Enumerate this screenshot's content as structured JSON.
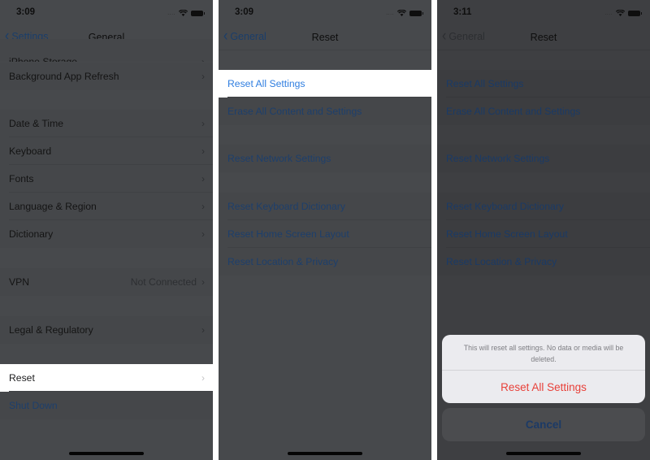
{
  "colors": {
    "ios_blue": "#2f7ee0",
    "destructive_red": "#e8413a",
    "dim_overlay_bg": "#47494c",
    "highlight_bg": "#ffffff"
  },
  "screens": [
    {
      "status": {
        "time": "3:09",
        "signal_icon": "signal-dots-icon",
        "wifi_icon": "wifi-icon",
        "battery_icon": "battery-icon"
      },
      "nav": {
        "back_label": "Settings",
        "title": "General"
      },
      "rows": [
        {
          "label": "iPhone Storage",
          "partial": true
        },
        {
          "label": "Background App Refresh"
        },
        {
          "label": "Date & Time"
        },
        {
          "label": "Keyboard"
        },
        {
          "label": "Fonts"
        },
        {
          "label": "Language & Region"
        },
        {
          "label": "Dictionary"
        },
        {
          "label": "VPN",
          "value": "Not Connected"
        },
        {
          "label": "Legal & Regulatory"
        },
        {
          "label": "Reset",
          "highlighted": true
        },
        {
          "label": "Shut Down",
          "style": "blue"
        }
      ]
    },
    {
      "status": {
        "time": "3:09",
        "signal_icon": "signal-dots-icon",
        "wifi_icon": "wifi-icon",
        "battery_icon": "battery-icon"
      },
      "nav": {
        "back_label": "General",
        "title": "Reset"
      },
      "rows": [
        {
          "label": "Reset All Settings",
          "highlighted": true
        },
        {
          "label": "Erase All Content and Settings"
        },
        {
          "label": "Reset Network Settings"
        },
        {
          "label": "Reset Keyboard Dictionary"
        },
        {
          "label": "Reset Home Screen Layout"
        },
        {
          "label": "Reset Location & Privacy"
        }
      ]
    },
    {
      "status": {
        "time": "3:11",
        "signal_icon": "signal-dots-icon",
        "wifi_icon": "wifi-icon",
        "battery_icon": "battery-icon"
      },
      "nav": {
        "back_label": "General",
        "title": "Reset"
      },
      "rows": [
        {
          "label": "Reset All Settings"
        },
        {
          "label": "Erase All Content and Settings"
        },
        {
          "label": "Reset Network Settings"
        },
        {
          "label": "Reset Keyboard Dictionary"
        },
        {
          "label": "Reset Home Screen Layout"
        },
        {
          "label": "Reset Location & Privacy"
        }
      ],
      "action_sheet": {
        "message": "This will reset all settings. No data or media will be deleted.",
        "confirm_label": "Reset All Settings",
        "cancel_label": "Cancel"
      }
    }
  ],
  "chevron_glyph": "›",
  "back_chevron_glyph": "‹",
  "signal_dots": "....",
  "wifi_glyph": "⌔"
}
